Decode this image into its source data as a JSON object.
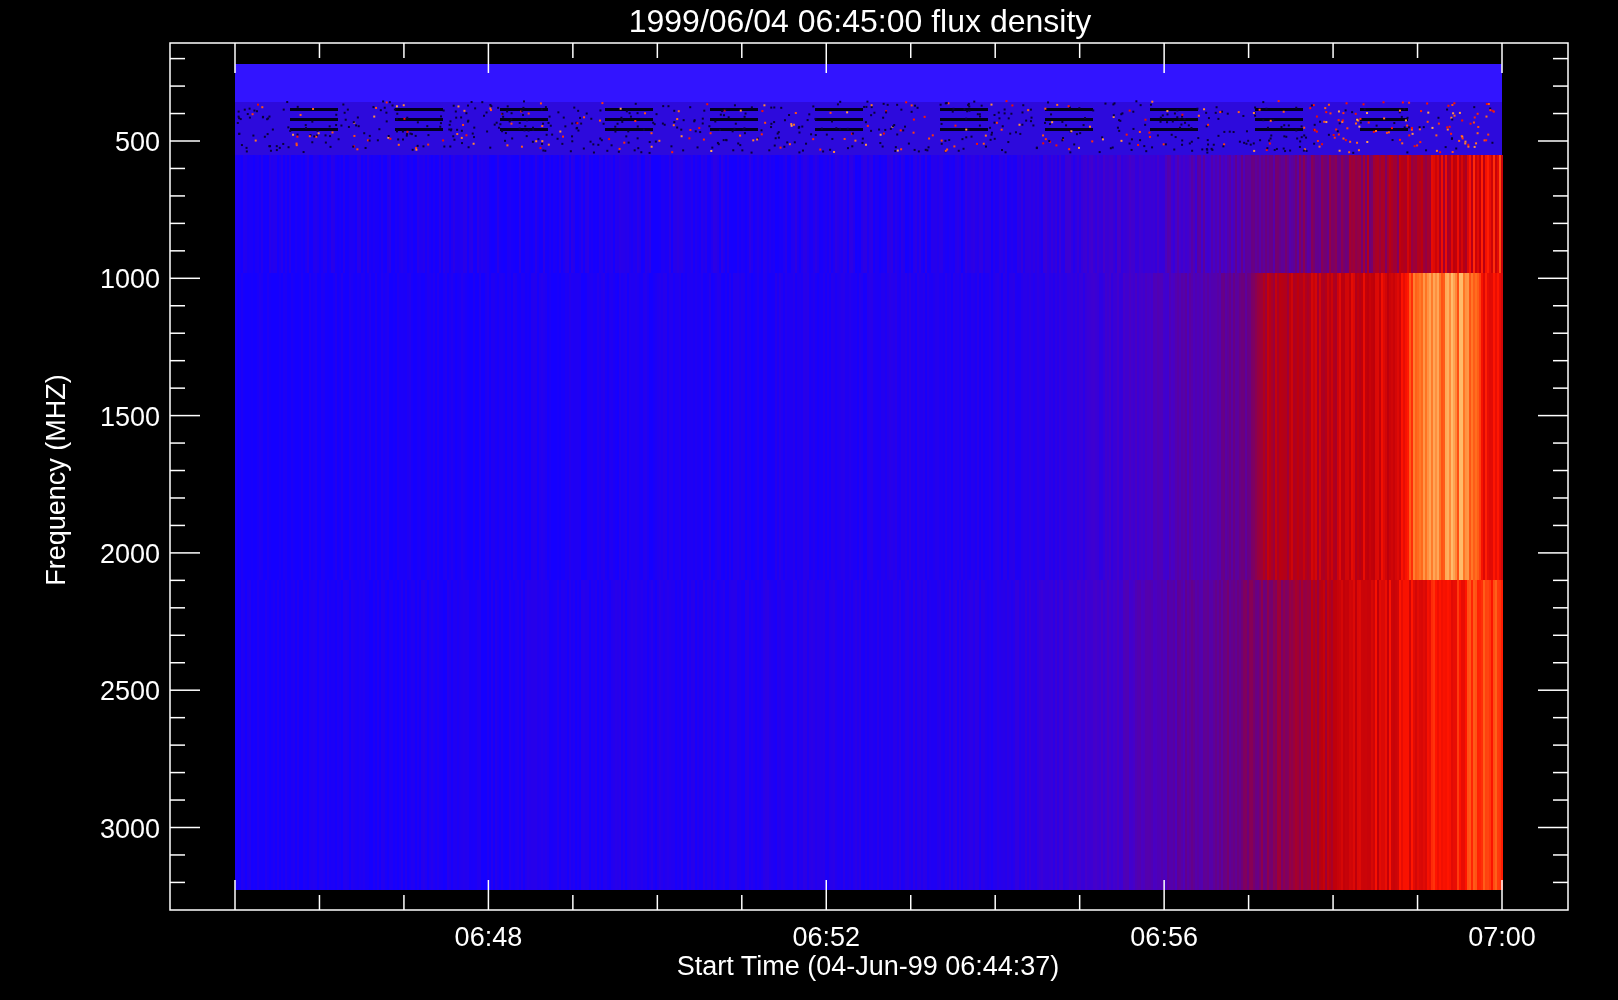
{
  "title": "1999/06/04 06:45:00 flux density",
  "y_axis": {
    "label": "Frequency (MHZ)",
    "ticks": [
      "500",
      "1000",
      "1500",
      "2000",
      "2500",
      "3000"
    ]
  },
  "x_axis": {
    "label": "Start Time (04-Jun-99 06:44:37)",
    "ticks": [
      "06:48",
      "06:52",
      "06:56",
      "07:00"
    ]
  }
}
